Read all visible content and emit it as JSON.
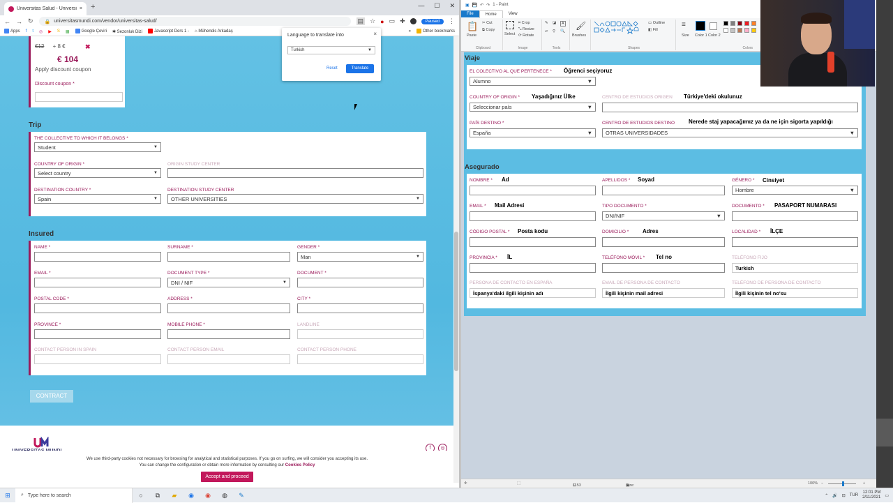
{
  "chrome": {
    "tab_title": "Universitas Salud - Universitas M",
    "new_tab": "+",
    "url": "universitasmundi.com/vendor/universitas-salud/",
    "paused": "Paused",
    "bookmarks": [
      "Apps",
      "Google Çeviri",
      "Sezonluk Dizi",
      "Javascript Ders 1 -",
      "Mühendis Arkadaş",
      "Other bookmarks"
    ],
    "win_min": "—",
    "win_max": "☐",
    "win_close": "✕"
  },
  "translate": {
    "title": "Language to translate into",
    "selected": "Turkish",
    "reset": "Reset",
    "translate": "Translate",
    "close": "×"
  },
  "price": {
    "old": "€12",
    "discount": "+ 8 €",
    "remove": "✖",
    "total": "€ 104",
    "coupon_title": "Apply discount coupon",
    "coupon_label": "Discount coupon *"
  },
  "trip": {
    "title": "Trip",
    "collective_label": "THE COLLECTIVE TO WHICH IT BELONGS *",
    "collective_value": "Student",
    "origin_country_label": "COUNTRY OF ORIGIN *",
    "origin_country_value": "Select country",
    "origin_center_label": "ORIGIN STUDY CENTER",
    "dest_country_label": "DESTINATION COUNTRY *",
    "dest_country_value": "Spain",
    "dest_center_label": "DESTINATION STUDY CENTER",
    "dest_center_value": "OTHER UNIVERSITIES"
  },
  "insured": {
    "title": "Insured",
    "name": "NAME *",
    "surname": "SURNAME *",
    "gender": "GENDER *",
    "gender_value": "Man",
    "email": "EMAIL *",
    "doc_type": "DOCUMENT TYPE *",
    "doc_type_value": "DNI / NIF",
    "document": "DOCUMENT *",
    "postal": "POSTAL CODE *",
    "address": "ADDRESS *",
    "city": "CITY *",
    "province": "PROVINCE *",
    "mobile": "MOBILE PHONE *",
    "landline": "LANDLINE",
    "contact_spain": "CONTACT PERSON IN SPAIN",
    "contact_email": "CONTACT PERSON EMAIL",
    "contact_phone": "CONTACT PERSON PHONE"
  },
  "contract": "CONTRACT",
  "footer": {
    "logo": "UNIVERSITAS MUNDI",
    "facebook": "f",
    "instagram": "◎",
    "cookie_line1": "We use third-party cookies not necessary for browsing for analytical and statistical purposes. If you go on surfing, we will consider you accepting its use.",
    "cookie_line2": "You can change the configuration or obtain more information by consulting our",
    "cookie_link": "Cookies Policy",
    "accept": "Accept and proceed"
  },
  "paint": {
    "title": "1 - Paint",
    "menu": [
      "File",
      "Home",
      "View"
    ],
    "groups": [
      "Clipboard",
      "Image",
      "Tools",
      "Shapes",
      "Colors"
    ],
    "tool_labels": [
      "Paste",
      "Cut",
      "Copy",
      "Select",
      "Crop",
      "Resize",
      "Rotate",
      "Brushes",
      "Outline",
      "Fill",
      "Size",
      "Color 1",
      "Color 2"
    ],
    "status_size": "1153 × 751px",
    "status_file": "Size: 138.0KB",
    "zoom": "100%",
    "zoom_minus": "−",
    "zoom_plus": "+",
    "viaje": "Viaje",
    "asegurado": "Asegurado",
    "fields": {
      "colectivo": "EL COLECTIVO AL QUE PERTENECE *",
      "colectivo_val": "Alumno",
      "pais_origen": "COUNTRY OF ORIGIN *",
      "pais_origen_val": "Seleccionar país",
      "centro_origen": "CENTRO DE ESTUDIOS ORIGEN",
      "pais_destino": "PAÍS DESTINO *",
      "pais_destino_val": "España",
      "centro_destino": "CENTRO DE ESTUDIOS DESTINO",
      "centro_destino_val": "OTRAS UNIVERSIDADES",
      "nombre": "NOMBRE *",
      "apellidos": "APELLIDOS *",
      "genero": "GÉNERO *",
      "genero_val": "Hombre",
      "email": "EMAIL *",
      "tipo_doc": "TIPO DOCUMENTO *",
      "tipo_doc_val": "DNI/NIF",
      "documento": "DOCUMENTO *",
      "postal": "CÓDIGO POSTAL *",
      "domicilio": "DOMICILIO *",
      "localidad": "LOCALIDAD *",
      "provincia": "PROVINCIA *",
      "movil": "TELÉFONO MÓVIL *",
      "fijo": "TELÉFONO FIJO",
      "contacto_es": "PERSONA DE CONTACTO EN ESPAÑA",
      "contacto_email": "EMAIL DE PERSONA DE CONTACTO",
      "contacto_tel": "TELÉFONO DE PERSONA DE CONTACTO"
    },
    "annotations": {
      "colectivo": "Öğrenci seçiyoruz",
      "pais_origen": "Yaşadığınız Ülke",
      "centro_origen": "Türkiye'deki okulunuz",
      "centro_destino": "Nerede staj yapacağımız ya da ne için sigorta yapıldığı",
      "nombre": "Ad",
      "apellidos": "Soyad",
      "genero": "Cinsiyet",
      "email": "Mail Adresi",
      "documento": "PASAPORT NUMARASI",
      "postal": "Posta kodu",
      "domicilio": "Adres",
      "localidad": "İLÇE",
      "provincia": "İL",
      "movil": "Tel no",
      "fijo": "Turkish",
      "contacto_es": "İspanya'daki ilgili kişinin adı",
      "contacto_email": "İlgili kişinin mail adresi",
      "contacto_tel": "İlgili kişinin tel no'su"
    }
  },
  "taskbar": {
    "search": "Type here to search",
    "lang": "TUR",
    "time": "12:01 PM",
    "date": "2/11/2021"
  },
  "colors": {
    "accent": "#9a1a5a",
    "sky": "#5cbde3",
    "chrome_blue": "#1a73e8"
  }
}
